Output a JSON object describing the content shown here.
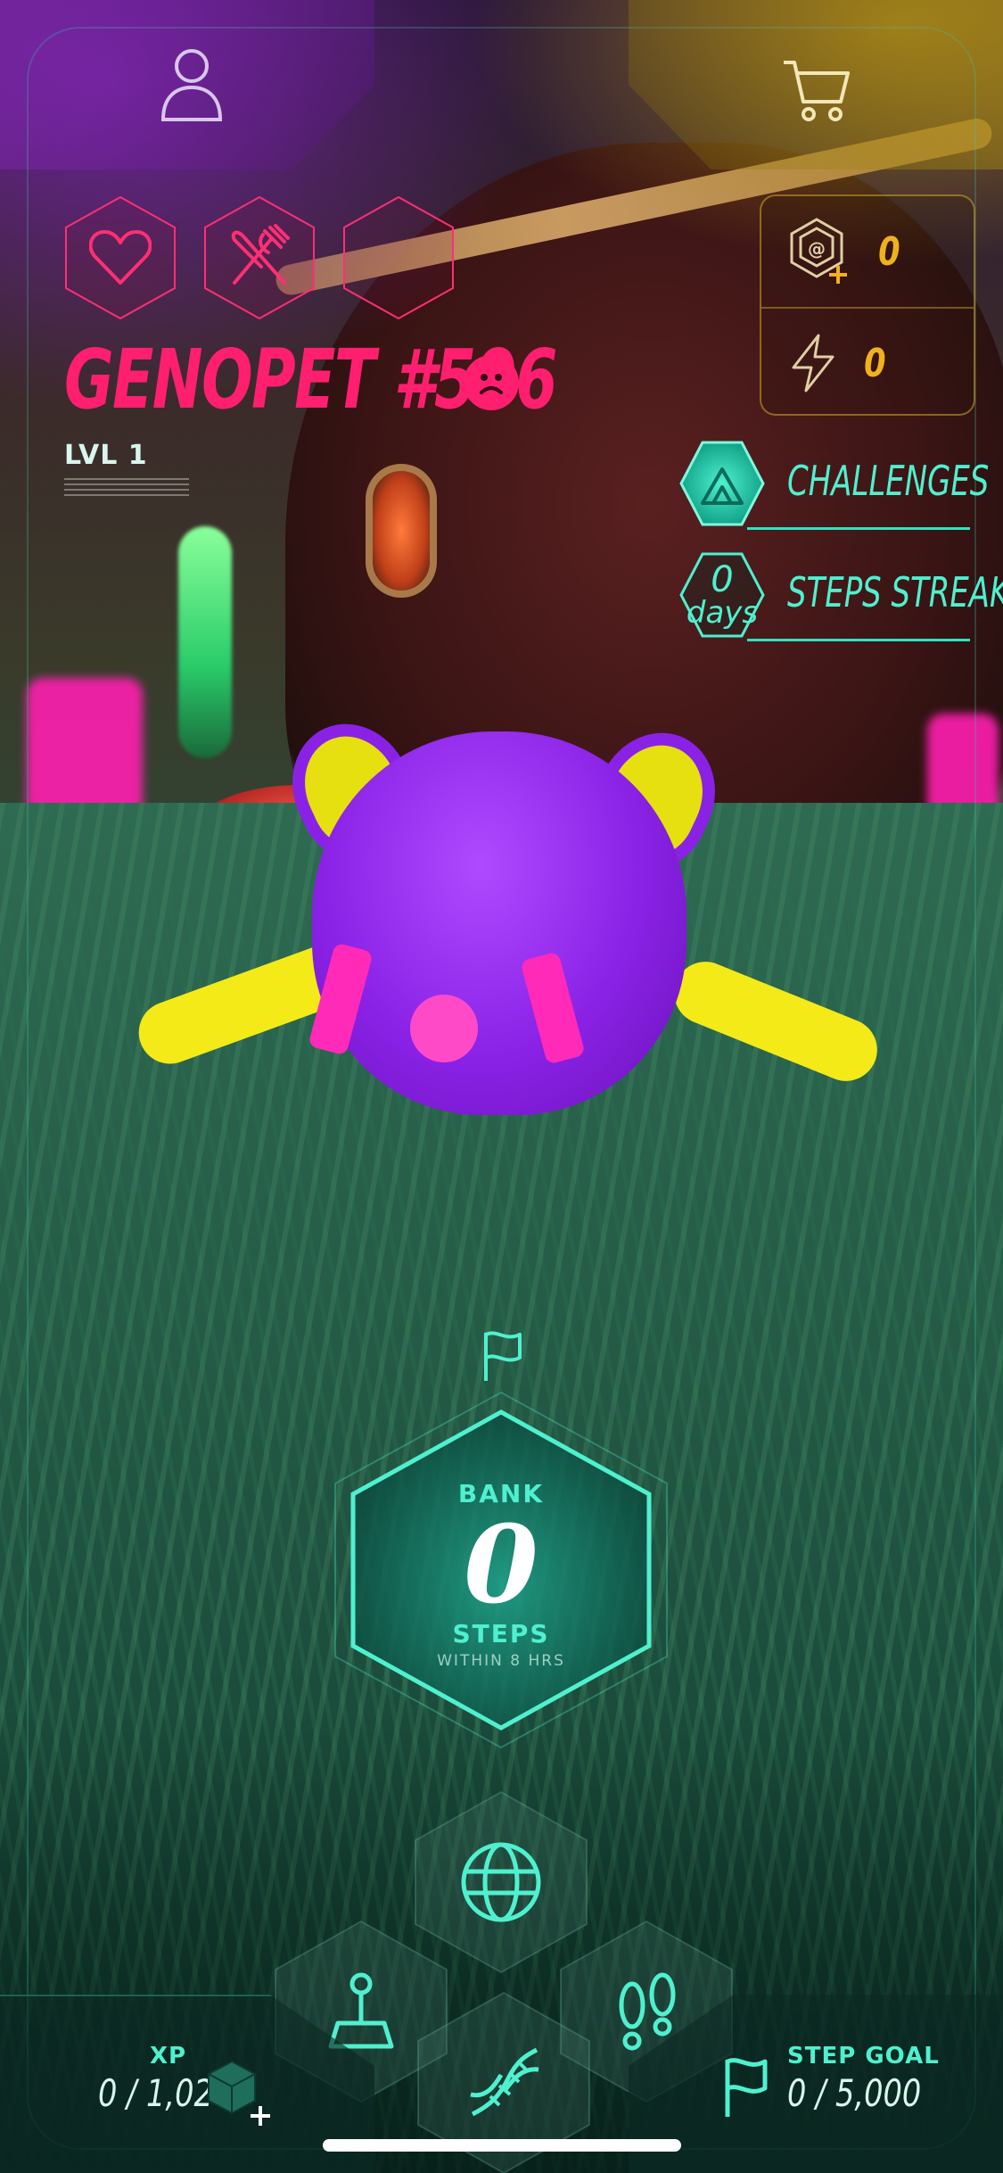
{
  "pet": {
    "name": "GENOPET #596",
    "level": "LVL 1",
    "mood": "sad"
  },
  "status_hexes": [
    {
      "name": "health",
      "icon": "heart-icon"
    },
    {
      "name": "food",
      "icon": "fork-knife-icon"
    },
    {
      "name": "empty",
      "icon": ""
    }
  ],
  "currency": {
    "gene": {
      "icon": "gene-token-icon",
      "value": "0"
    },
    "energy": {
      "icon": "lightning-icon",
      "value": "0"
    }
  },
  "side_menu": {
    "challenges": {
      "label": "CHALLENGES"
    },
    "streak": {
      "label": "STEPS STREAK",
      "count": "0",
      "unit": "days"
    }
  },
  "bank": {
    "label": "BANK",
    "value": "0",
    "unit": "STEPS",
    "sub": "WITHIN 8 HRS"
  },
  "xp": {
    "label": "XP",
    "current": "0",
    "max": "1,020",
    "display": "0 / 1,020"
  },
  "step_goal": {
    "label": "STEP GOAL",
    "current": "0",
    "max": "5,000",
    "display": "0 / 5,000"
  },
  "nav": [
    "world-icon",
    "joystick-icon",
    "dna-icon",
    "footprints-icon"
  ],
  "colors": {
    "accent": "#4ff0cf",
    "pet_name": "#ff1f6e",
    "currency": "#f0b21a"
  }
}
